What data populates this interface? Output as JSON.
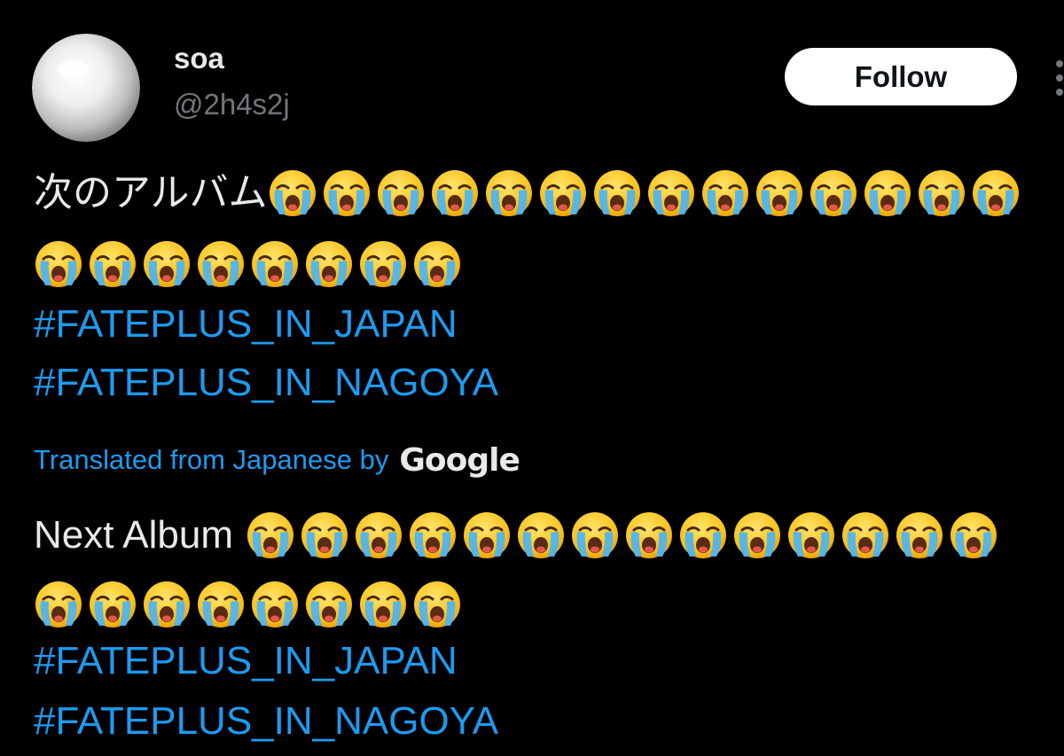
{
  "author": {
    "display_name": "soa",
    "handle": "@2h4s2j"
  },
  "follow_button_label": "Follow",
  "original": {
    "text": "次のアルバム",
    "emoji": "loudly-crying-face",
    "emoji_counts": [
      14,
      8
    ],
    "hashtags": [
      "#FATEPLUS_IN_JAPAN",
      "#FATEPLUS_IN_NAGOYA"
    ]
  },
  "translation": {
    "label": "Translated from Japanese by",
    "provider": "Google",
    "text": "Next Album",
    "emoji_counts": [
      14,
      8
    ],
    "hashtags": [
      "#FATEPLUS_IN_JAPAN",
      "#FATEPLUS_IN_NAGOYA"
    ]
  },
  "colors": {
    "background": "#000000",
    "text": "#e7e9ea",
    "secondary_text": "#71767b",
    "link": "#1d9bf0",
    "follow_bg": "#ffffff"
  },
  "icons": {
    "more": "more-options-icon",
    "avatar": "pearl-avatar"
  }
}
